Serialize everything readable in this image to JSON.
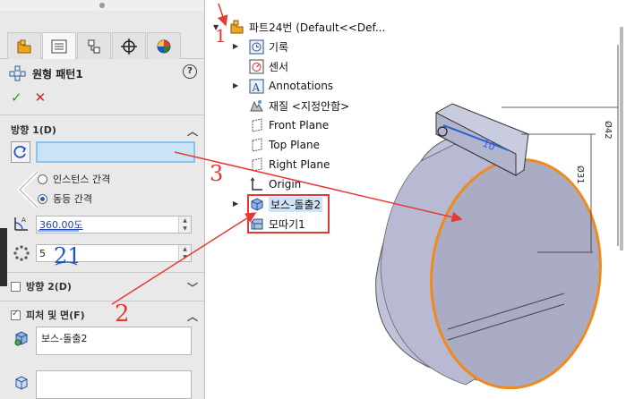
{
  "property_manager": {
    "tabs": [
      "feature-manager",
      "property-manager",
      "configuration-manager",
      "dimxpert-manager",
      "display-manager"
    ],
    "title": "원형 패턴1",
    "ok_label": "✓",
    "cancel_label": "✕",
    "help_label": "?",
    "direction1": {
      "header": "방향 1(D)",
      "reference_value": "",
      "radio_instance_spacing": "인스턴스 간격",
      "radio_equal_spacing": "동등 간격",
      "selected": "동등 간격",
      "angle": "360.00도",
      "instances": "5"
    },
    "direction2": {
      "header": "방향 2(D)",
      "checked": false
    },
    "features_faces": {
      "header": "피처 및 면(F)",
      "checked": true,
      "features": [
        "보스-돌출2"
      ]
    }
  },
  "tree": {
    "root": "파트24번  (Default<<Def...",
    "items": [
      {
        "label": "기록",
        "icon": "history-icon",
        "expandable": true
      },
      {
        "label": "센서",
        "icon": "sensor-icon",
        "expandable": false
      },
      {
        "label": "Annotations",
        "icon": "annotations-icon",
        "expandable": true
      },
      {
        "label": "재질 <지정안함>",
        "icon": "material-icon",
        "expandable": false
      },
      {
        "label": "Front Plane",
        "icon": "plane-icon",
        "expandable": false
      },
      {
        "label": "Top Plane",
        "icon": "plane-icon",
        "expandable": false
      },
      {
        "label": "Right Plane",
        "icon": "plane-icon",
        "expandable": false
      },
      {
        "label": "Origin",
        "icon": "origin-icon",
        "expandable": false
      },
      {
        "label": "보스-돌출2",
        "icon": "boss-extrude-icon",
        "expandable": true,
        "selected": true
      },
      {
        "label": "모따기1",
        "icon": "chamfer-icon",
        "expandable": false
      }
    ]
  },
  "model": {
    "dimensions": [
      "Ø31",
      "Ø42",
      "10"
    ],
    "accent_edge": "#f08a1c",
    "body_color": "#a9acc4"
  },
  "annotations": {
    "marks": [
      "1",
      "2",
      "3",
      "21"
    ],
    "color": "#e53935"
  }
}
